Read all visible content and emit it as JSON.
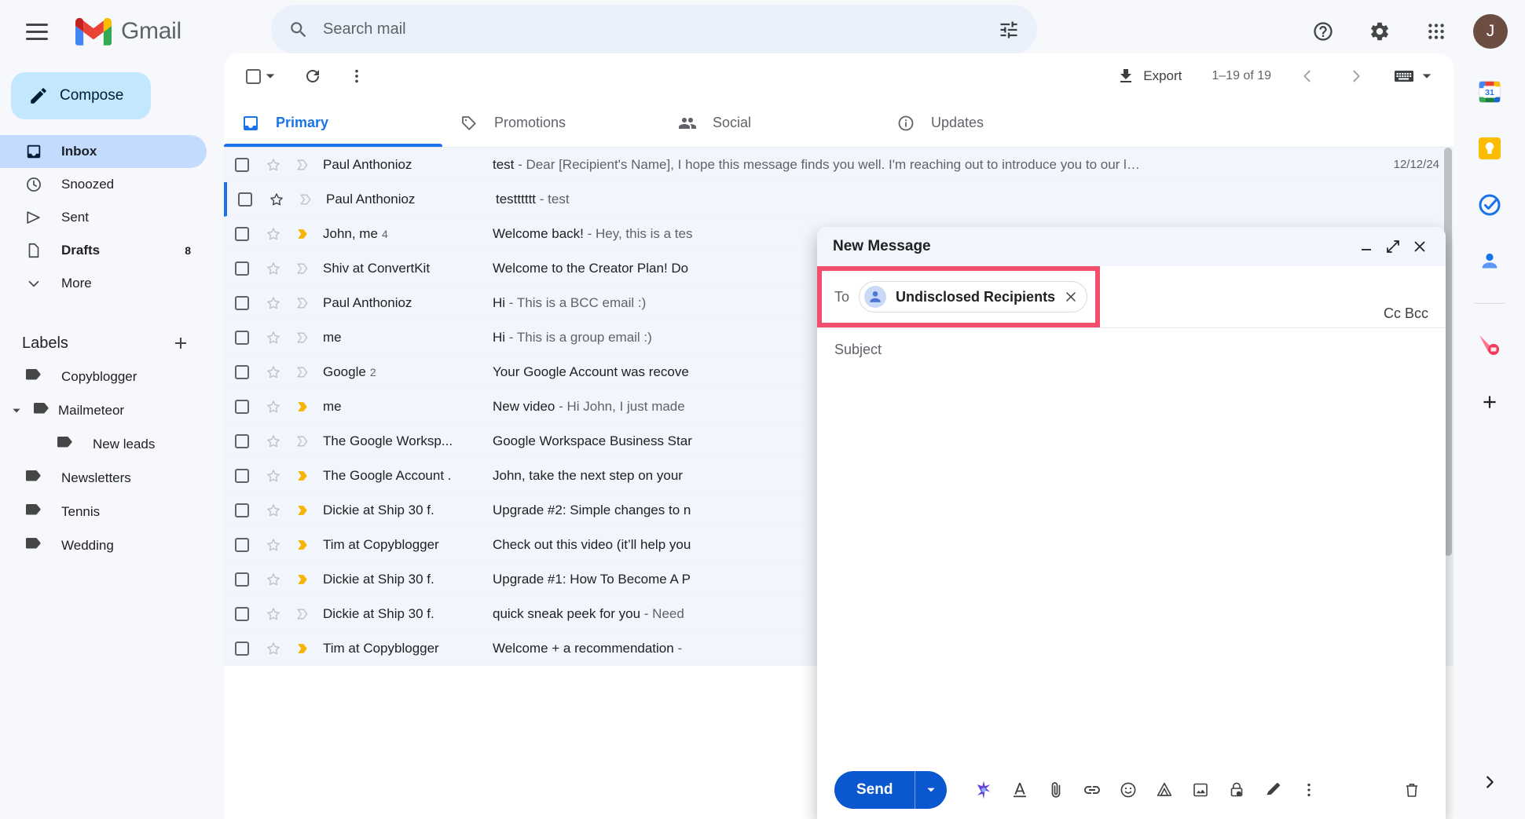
{
  "app": {
    "brand_name": "Gmail",
    "menu_icon": "hamburger-icon",
    "logo_icon": "gmail-logo-icon"
  },
  "search": {
    "placeholder": "Search mail",
    "value": "",
    "search_icon": "search-icon",
    "options_icon": "search-options-icon"
  },
  "topbar": {
    "help_icon": "help-icon",
    "settings_icon": "gear-icon",
    "apps_icon": "google-apps-grid-icon",
    "avatar_initial": "J"
  },
  "sidebar": {
    "compose_label": "Compose",
    "compose_icon": "pencil-icon",
    "nav_items": [
      {
        "label": "Inbox",
        "icon": "inbox-icon",
        "count": "",
        "active": true
      },
      {
        "label": "Snoozed",
        "icon": "clock-icon",
        "count": "",
        "active": false
      },
      {
        "label": "Sent",
        "icon": "send-icon",
        "count": "",
        "active": false
      },
      {
        "label": "Drafts",
        "icon": "draft-icon",
        "count": "8",
        "active": false
      },
      {
        "label": "More",
        "icon": "chevron-down-icon",
        "count": "",
        "active": false
      }
    ],
    "labels_title": "Labels",
    "add_label_icon": "plus-icon",
    "labels": [
      {
        "label": "Copyblogger",
        "nested": false,
        "caret": false
      },
      {
        "label": "Mailmeteor",
        "nested": false,
        "caret": true
      },
      {
        "label": "New leads",
        "nested": true,
        "caret": false
      },
      {
        "label": "Newsletters",
        "nested": false,
        "caret": false
      },
      {
        "label": "Tennis",
        "nested": false,
        "caret": false
      },
      {
        "label": "Wedding",
        "nested": false,
        "caret": false
      }
    ]
  },
  "toolbar": {
    "select_all_icon": "checkbox-icon",
    "select_dropdown_icon": "chevron-down-icon",
    "refresh_icon": "refresh-icon",
    "more_icon": "more-vertical-icon",
    "export_label": "Export",
    "export_icon": "download-icon",
    "range_label": "1–19 of 19",
    "prev_icon": "chevron-left-icon",
    "next_icon": "chevron-right-icon",
    "keyboard_icon": "keyboard-icon",
    "keyboard_caret_icon": "chevron-down-icon"
  },
  "tabs": [
    {
      "label": "Primary",
      "icon": "inbox-tab-icon",
      "active": true
    },
    {
      "label": "Promotions",
      "icon": "tag-icon",
      "active": false
    },
    {
      "label": "Social",
      "icon": "people-icon",
      "active": false
    },
    {
      "label": "Updates",
      "icon": "info-icon",
      "active": false
    }
  ],
  "emails": [
    {
      "sender": "Paul Anthonioz",
      "count": "",
      "subject": "test",
      "snippet": " - Dear [Recipient's Name], I hope this message finds you well. I'm reaching out to introduce you to our l…",
      "date": "12/12/24",
      "starred": false,
      "important": false,
      "selected": false
    },
    {
      "sender": "Paul Anthonioz",
      "count": "",
      "subject": "testttttt",
      "snippet": " - test",
      "date": "",
      "starred": true,
      "important": false,
      "selected": true
    },
    {
      "sender": "John, me",
      "count": "4",
      "subject": "Welcome back!",
      "snippet": " - Hey, this is a tes",
      "date": "",
      "starred": false,
      "important": true,
      "selected": false
    },
    {
      "sender": "Shiv at ConvertKit",
      "count": "",
      "subject": "Welcome to the Creator Plan! Do",
      "snippet": "",
      "date": "",
      "starred": false,
      "important": false,
      "selected": false
    },
    {
      "sender": "Paul Anthonioz",
      "count": "",
      "subject": "Hi",
      "snippet": " - This is a BCC email :)",
      "date": "",
      "starred": false,
      "important": false,
      "selected": false
    },
    {
      "sender": "me",
      "count": "",
      "subject": "Hi",
      "snippet": " - This is a group email :)",
      "date": "",
      "starred": false,
      "important": false,
      "selected": false
    },
    {
      "sender": "Google",
      "count": "2",
      "subject": "Your Google Account was recove",
      "snippet": "",
      "date": "",
      "starred": false,
      "important": false,
      "selected": false
    },
    {
      "sender": "me",
      "count": "",
      "subject": "New video",
      "snippet": " - Hi John, I just made ",
      "date": "",
      "starred": false,
      "important": true,
      "selected": false
    },
    {
      "sender": "The Google Worksp...",
      "count": "",
      "subject": "Google Workspace Business Star",
      "snippet": "",
      "date": "",
      "starred": false,
      "important": false,
      "selected": false
    },
    {
      "sender": "The Google Account .",
      "count": "",
      "subject": "John, take the next step on your ",
      "snippet": "",
      "date": "",
      "starred": false,
      "important": true,
      "selected": false
    },
    {
      "sender": "Dickie at Ship 30 f.",
      "count": "",
      "subject": "Upgrade #2: Simple changes to n",
      "snippet": "",
      "date": "",
      "starred": false,
      "important": true,
      "selected": false
    },
    {
      "sender": "Tim at Copyblogger",
      "count": "",
      "subject": "Check out this video (it’ll help you",
      "snippet": "",
      "date": "",
      "starred": false,
      "important": true,
      "selected": false
    },
    {
      "sender": "Dickie at Ship 30 f.",
      "count": "",
      "subject": "Upgrade #1: How To Become A P",
      "snippet": "",
      "date": "",
      "starred": false,
      "important": true,
      "selected": false
    },
    {
      "sender": "Dickie at Ship 30 f.",
      "count": "",
      "subject": "quick sneak peek for you",
      "snippet": " - Need",
      "date": "",
      "starred": false,
      "important": false,
      "selected": false
    },
    {
      "sender": "Tim at Copyblogger",
      "count": "",
      "subject": "Welcome + a recommendation",
      "snippet": " - ",
      "date": "",
      "starred": false,
      "important": true,
      "selected": false
    }
  ],
  "compose": {
    "title": "New Message",
    "minimize_icon": "minimize-icon",
    "popout_icon": "popout-icon",
    "close_icon": "close-icon",
    "to_label": "To",
    "recipient_chip": "Undisclosed Recipients",
    "chip_remove_icon": "close-icon",
    "cc_bcc_label": "Cc Bcc",
    "subject_placeholder": "Subject",
    "subject_value": "",
    "body_value": "",
    "send_label": "Send",
    "send_caret_icon": "chevron-down-icon",
    "highlight_color": "#f24e6e",
    "send_color": "#0b57d0",
    "footer_icons": [
      "gemini-sparkle-icon",
      "text-format-icon",
      "attach-file-icon",
      "insert-link-icon",
      "insert-emoji-icon",
      "insert-drive-icon",
      "insert-photo-icon",
      "confidential-mode-icon",
      "insert-signature-icon",
      "more-options-icon"
    ],
    "discard_icon": "trash-icon"
  },
  "right_rail": {
    "icons": [
      "google-calendar-icon",
      "google-keep-icon",
      "google-tasks-icon",
      "google-contacts-icon"
    ],
    "addon_icon": "mailmeteor-icon",
    "add_icon": "plus-icon",
    "expand_icon": "chevron-right-icon"
  }
}
